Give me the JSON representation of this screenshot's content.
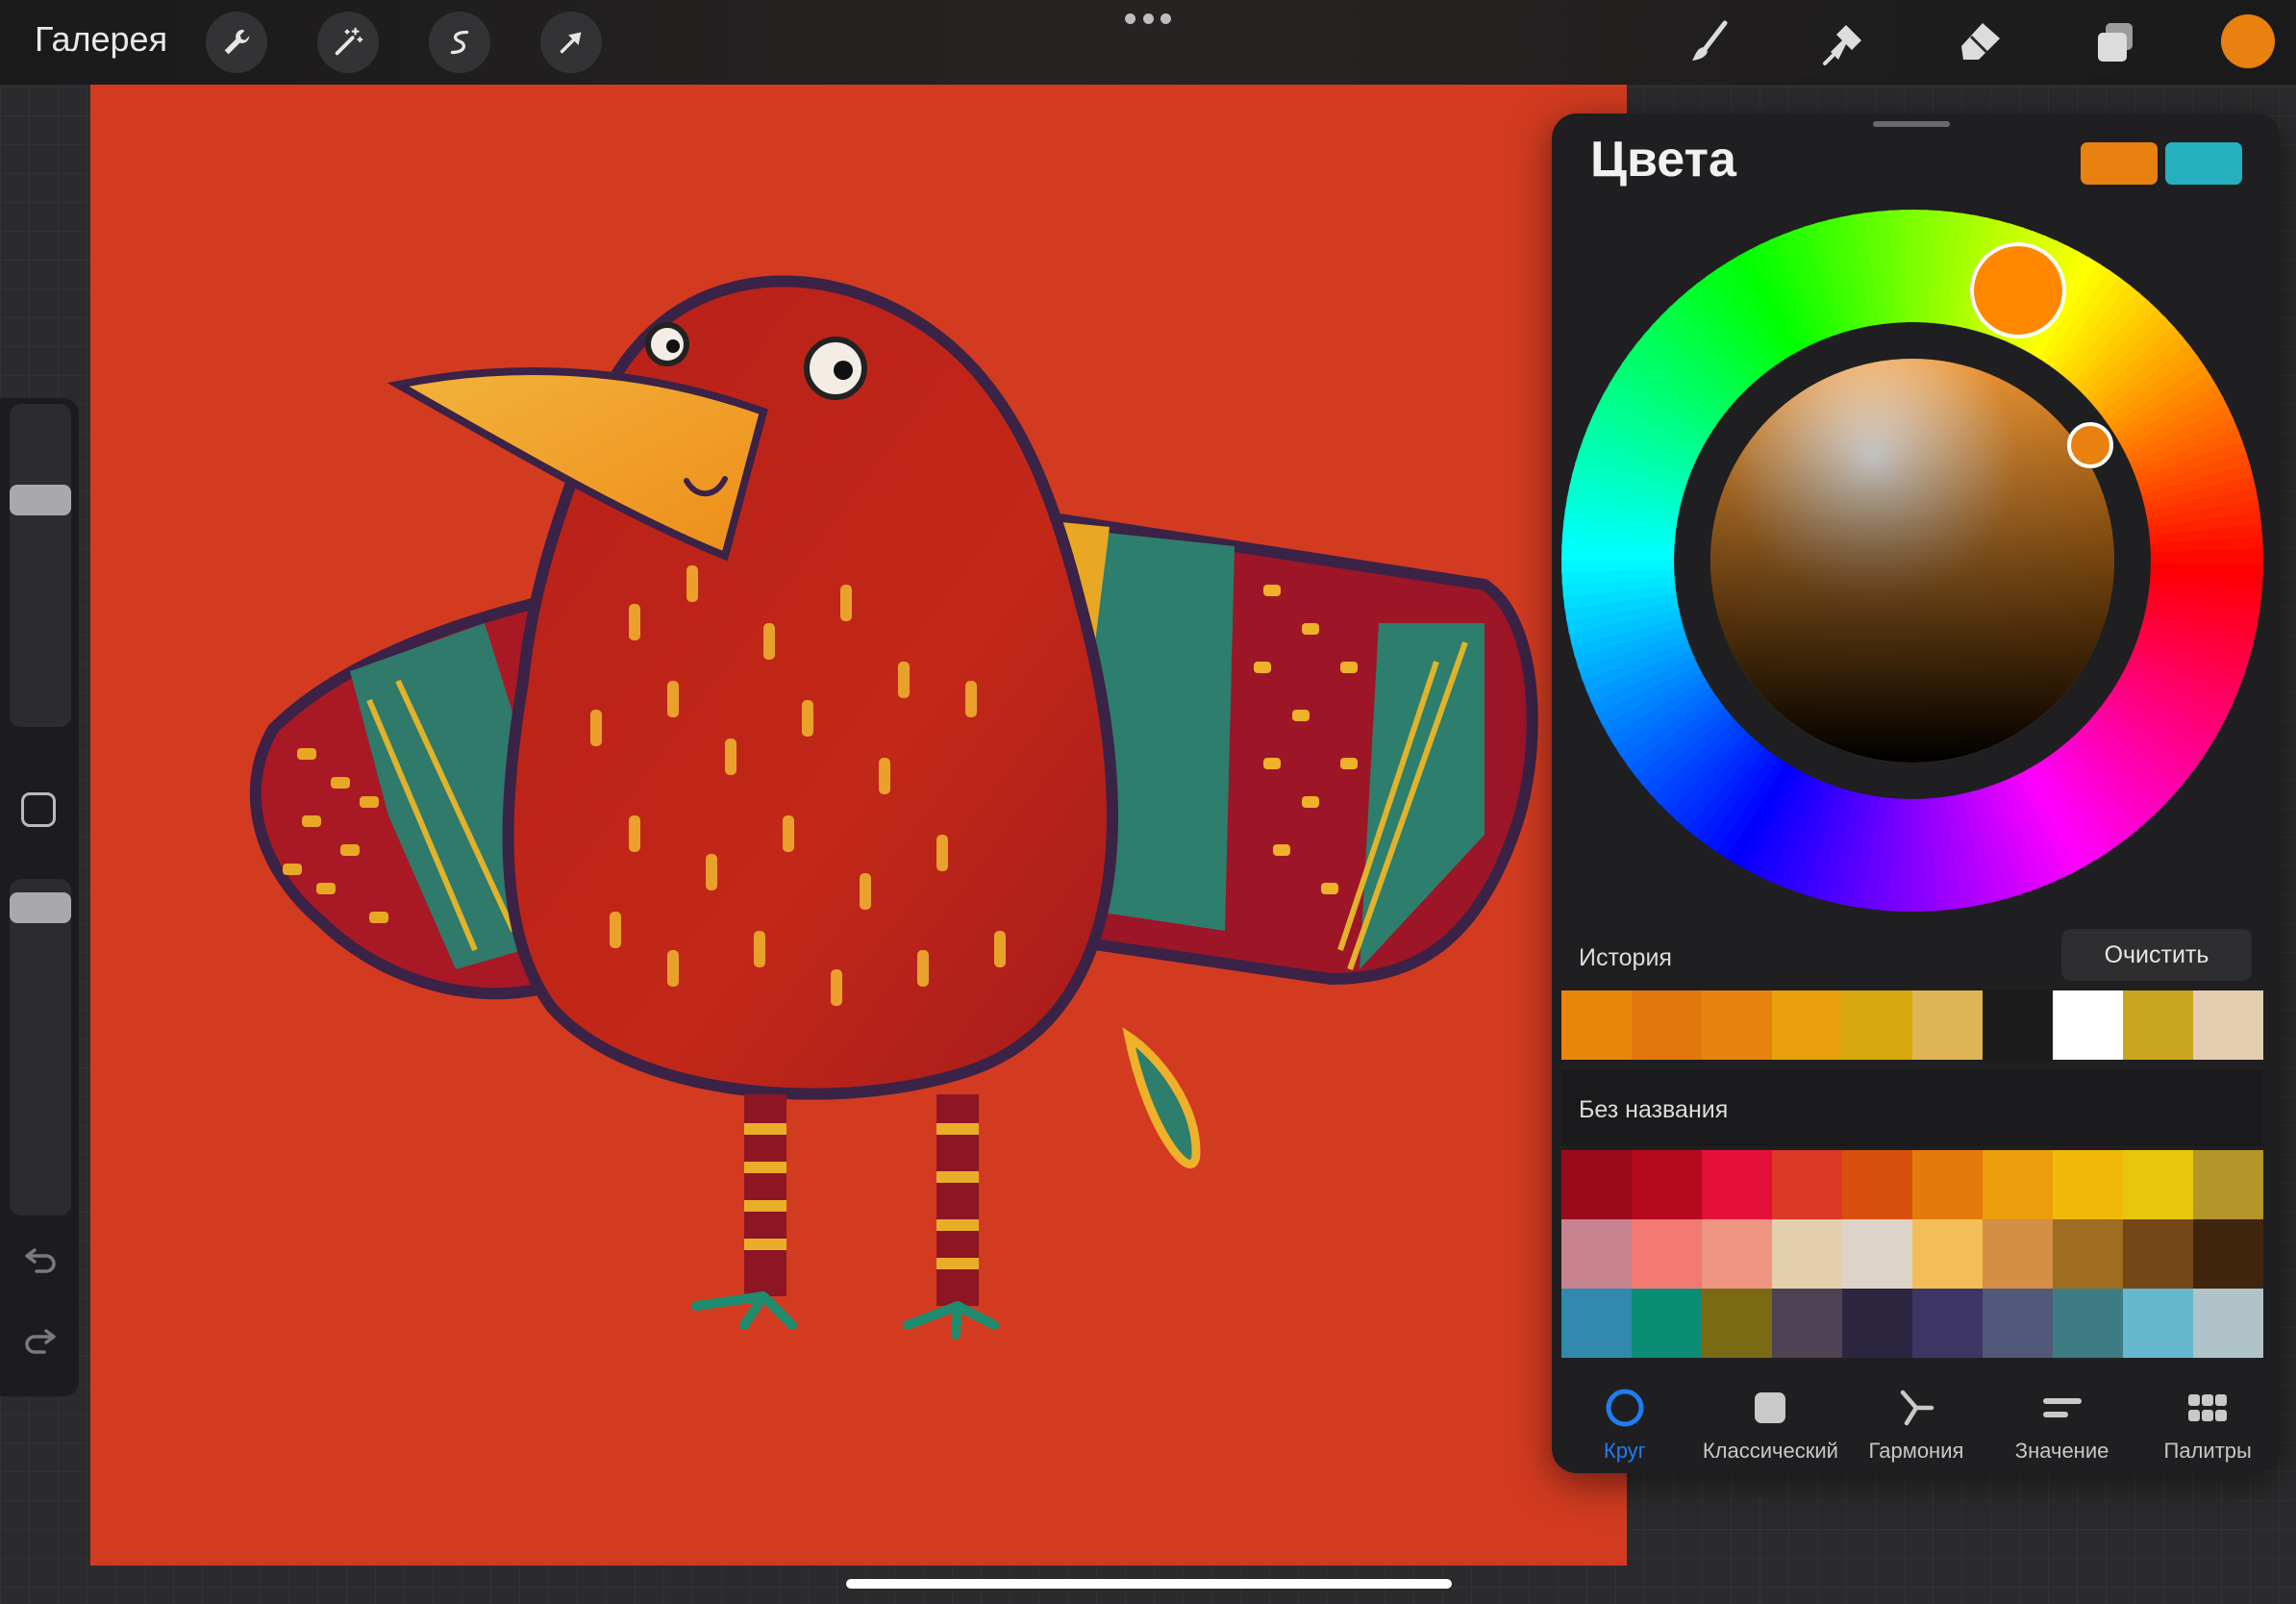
{
  "topbar": {
    "gallery_label": "Галерея",
    "left_tools": [
      "wrench-icon",
      "magic-wand-icon",
      "selection-icon",
      "transform-arrow-icon"
    ],
    "more_icon": "ellipsis-icon",
    "right_tools": [
      "brush-icon",
      "smudge-icon",
      "eraser-icon",
      "layers-icon"
    ],
    "current_color": "#E8810F"
  },
  "sidebar": {
    "brush_size_level": 0.3,
    "brush_opacity_level": 0.06,
    "modify_icon": "square-icon",
    "undo_icon": "undo-icon",
    "redo_icon": "redo-icon"
  },
  "colors_panel": {
    "title": "Цвета",
    "primary_color": "#E8810F",
    "secondary_color": "#25B0BE",
    "selected_hue_color": "#FF8800",
    "history": {
      "label": "История",
      "clear_label": "Очистить",
      "swatches": [
        "#E8860B",
        "#E2770D",
        "#E8830F",
        "#E8A10B",
        "#D8A80F",
        "#DDB555",
        "#1B1B1B",
        "#FFFFFF",
        "#C9A520",
        "#E3CDB1"
      ]
    },
    "palette": {
      "label": "Без названия",
      "swatches": [
        "#9A0A1B",
        "#B50A20",
        "#E5103A",
        "#DB3826",
        "#D8500E",
        "#E47A0B",
        "#EC9E0A",
        "#F1B80A",
        "#E6C70C",
        "#B3952A",
        "#C7838F",
        "#F27A72",
        "#EE9582",
        "#E4CFAD",
        "#DED3C8",
        "#F3BE57",
        "#D58E45",
        "#9E6D21",
        "#744716",
        "#40250F",
        "#318AAE",
        "#0A8C75",
        "#7B6A14",
        "#4E4255",
        "#2D2640",
        "#3D3563",
        "#51587A",
        "#3D7C85",
        "#66B8CF",
        "#B0C3C9"
      ]
    },
    "tabs": [
      {
        "label": "Круг",
        "icon": "circle-icon",
        "active": true
      },
      {
        "label": "Классический",
        "icon": "square-icon",
        "active": false
      },
      {
        "label": "Гармония",
        "icon": "harmony-icon",
        "active": false
      },
      {
        "label": "Значение",
        "icon": "sliders-icon",
        "active": false
      },
      {
        "label": "Палитры",
        "icon": "grid-icon",
        "active": false
      }
    ]
  }
}
